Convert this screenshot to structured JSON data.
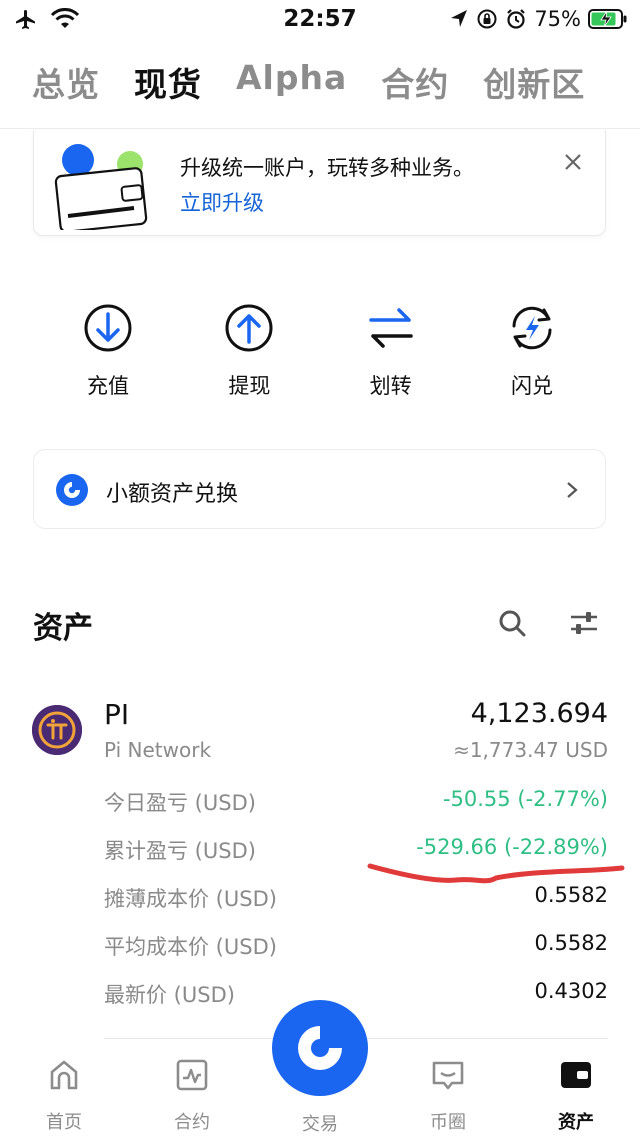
{
  "status_bar": {
    "time": "22:57",
    "battery_percent": "75%",
    "icons": [
      "airplane-icon",
      "wifi-icon",
      "location-icon",
      "rotation-lock-icon",
      "alarm-icon",
      "battery-charging-icon"
    ]
  },
  "tabs": [
    {
      "label": "总览",
      "active": false
    },
    {
      "label": "现货",
      "active": true
    },
    {
      "label": "Alpha",
      "active": false
    },
    {
      "label": "合约",
      "active": false
    },
    {
      "label": "创新区",
      "active": false
    }
  ],
  "banner": {
    "text": "升级统一账户，玩转多种业务。",
    "link": "立即升级",
    "icon": "wallet-illustration",
    "close_icon": "close-icon"
  },
  "actions": [
    {
      "label": "充值",
      "icon": "deposit-icon"
    },
    {
      "label": "提现",
      "icon": "withdraw-icon"
    },
    {
      "label": "划转",
      "icon": "transfer-icon"
    },
    {
      "label": "闪兑",
      "icon": "flash-swap-icon"
    }
  ],
  "small_asset_swap": {
    "label": "小额资产兑换",
    "icon": "swap-logo-icon",
    "chevron": "chevron-right-icon"
  },
  "assets": {
    "title": "资产",
    "search_icon": "search-icon",
    "filter_icon": "filter-icon",
    "items": [
      {
        "symbol": "PI",
        "name": "Pi Network",
        "quantity": "4,123.694",
        "usd_value": "≈1,773.47 USD",
        "logo_icon": "pi-network-logo",
        "rows": [
          {
            "label": "今日盈亏 (USD)",
            "value": "-50.55 (-2.77%)",
            "color": "#2fbf85"
          },
          {
            "label": "累计盈亏 (USD)",
            "value": "-529.66 (-22.89%)",
            "color": "#2fbf85"
          },
          {
            "label": "摊薄成本价 (USD)",
            "value": "0.5582",
            "color": "#111111"
          },
          {
            "label": "平均成本价 (USD)",
            "value": "0.5582",
            "color": "#111111"
          },
          {
            "label": "最新价 (USD)",
            "value": "0.4302",
            "color": "#111111"
          }
        ]
      }
    ]
  },
  "bottom_nav": [
    {
      "label": "首页",
      "icon": "home-icon",
      "active": false
    },
    {
      "label": "合约",
      "icon": "contract-chart-icon",
      "active": false
    },
    {
      "label": "交易",
      "icon": "trade-logo-icon",
      "active": false
    },
    {
      "label": "币圈",
      "icon": "feed-icon",
      "active": false
    },
    {
      "label": "资产",
      "icon": "wallet-icon",
      "active": true
    }
  ],
  "colors": {
    "brand_blue": "#1a66f0",
    "link_blue": "#1464d8",
    "profit_green": "#2fbf85",
    "annotation_red": "#e03a3a"
  }
}
